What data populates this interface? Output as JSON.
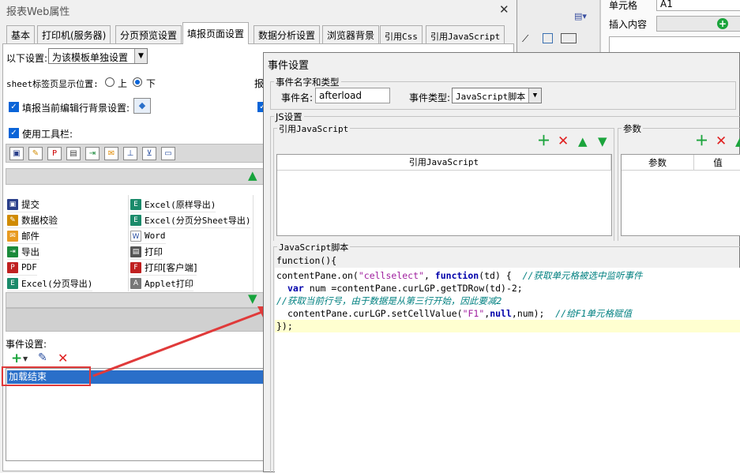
{
  "main_window": {
    "title": "报表Web属性",
    "close_glyph": "✕",
    "tabs": [
      "基本",
      "打印机(服务器)",
      "分页预览设置",
      "填报页面设置",
      "数据分析设置",
      "浏览器背景",
      "引用Css",
      "引用JavaScript"
    ],
    "active_tab": "填报页面设置"
  },
  "fill_page": {
    "settings_label": "以下设置:",
    "settings_select": "为该模板单独设置",
    "sheet_tab_label": "sheet标签页显示位置:",
    "sheet_top": "上",
    "sheet_bottom": "下",
    "truncated_label": "报",
    "bg_setting_label": "填报当前编辑行背景设置:",
    "toolbar_label": "使用工具栏:",
    "buttons_left": [
      "提交",
      "数据校验",
      "邮件",
      "导出",
      "PDF",
      "Excel(分页导出)"
    ],
    "buttons_right": [
      "Excel(原样导出)",
      "Excel(分页分Sheet导出)",
      "Word",
      "打印",
      "打印[客户端]",
      "Applet打印"
    ],
    "event_label": "事件设置:",
    "event_item": "加载结束"
  },
  "right_panel": {
    "cell_label": "单元格",
    "cell_value": "A1",
    "insert_label": "插入内容"
  },
  "event_dialog": {
    "title": "事件设置",
    "group_name_type": "事件名字和类型",
    "event_name_label": "事件名:",
    "event_name_value": "afterload",
    "event_type_label": "事件类型:",
    "event_type_value": "JavaScript脚本",
    "group_js": "JS设置",
    "group_ref_js": "引用JavaScript",
    "ref_js_header": "引用JavaScript",
    "group_params": "参数",
    "params_col1": "参数",
    "params_col2": "值",
    "group_script": "JavaScript脚本",
    "function_header": "function(){",
    "code": {
      "l1_a": "contentPane.on(",
      "l1_str": "\"cellselect\"",
      "l1_b": ", ",
      "l1_kw": "function",
      "l1_c": "(td) {  ",
      "l1_cmt": "//获取单元格被选中监听事件",
      "l2_kw": "var",
      "l2_rest": " num =contentPane.curLGP.getTDRow(td)-2;",
      "l3_cmt": "//获取当前行号，由于数据是从第三行开始，因此要减2",
      "l4_a": "contentPane.curLGP.setCellValue(",
      "l4_str": "\"F1\"",
      "l4_b": ",",
      "l4_kw1": "null",
      "l4_c": ",num);  ",
      "l4_cmt": "//给F1单元格赋值",
      "l5": "});"
    }
  },
  "colors": {
    "accent_blue": "#2a6fc9",
    "highlight_red": "#e03a3a",
    "green": "#1ba43c"
  }
}
